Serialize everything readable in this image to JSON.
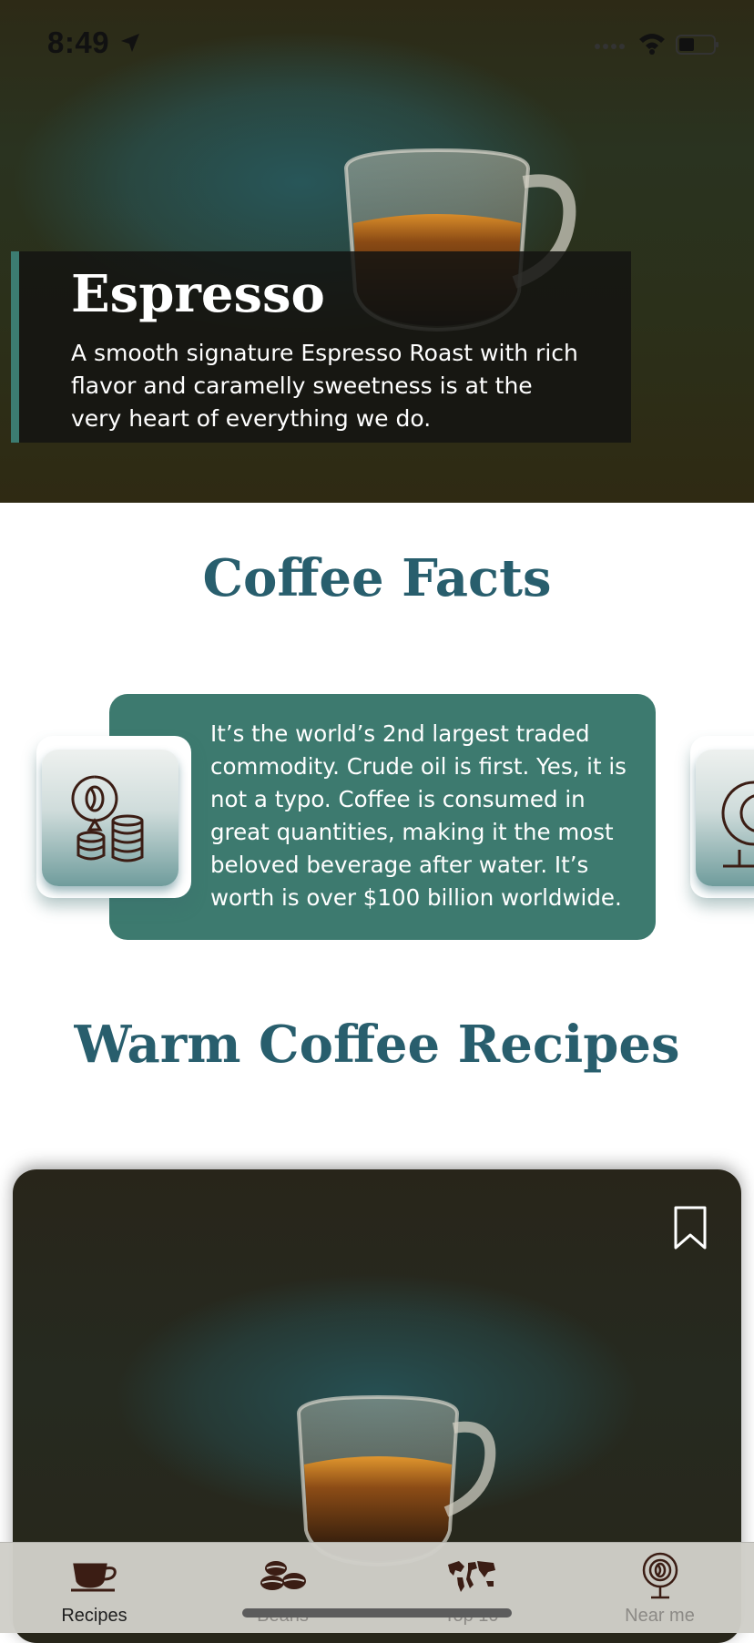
{
  "status_bar": {
    "time": "8:49"
  },
  "hero": {
    "title": "Espresso",
    "description": "A smooth signature Espresso Roast with rich flavor and caramelly sweetness is at the very heart of everything we do."
  },
  "facts_section": {
    "title": "Coffee Facts",
    "fact_text": "It’s the world’s 2nd largest traded commodity.  Crude oil is first. Yes, it is not a typo. Coffee is consumed in great quantities, making it the most beloved beverage after water. It’s worth is over $100 billion worldwide."
  },
  "recipes_section": {
    "title": "Warm Coffee Recipes"
  },
  "tabbar": {
    "items": [
      {
        "label": "Recipes",
        "icon": "coffee-cup-icon",
        "active": true
      },
      {
        "label": "Beans",
        "icon": "coffee-beans-icon",
        "active": false
      },
      {
        "label": "Top 10",
        "icon": "world-map-icon",
        "active": false
      },
      {
        "label": "Near me",
        "icon": "location-pin-coffee-icon",
        "active": false
      }
    ]
  },
  "colors": {
    "accent_teal": "#3d7a6f",
    "title_blue": "#285e6d",
    "icon_brown": "#3b1d14"
  }
}
